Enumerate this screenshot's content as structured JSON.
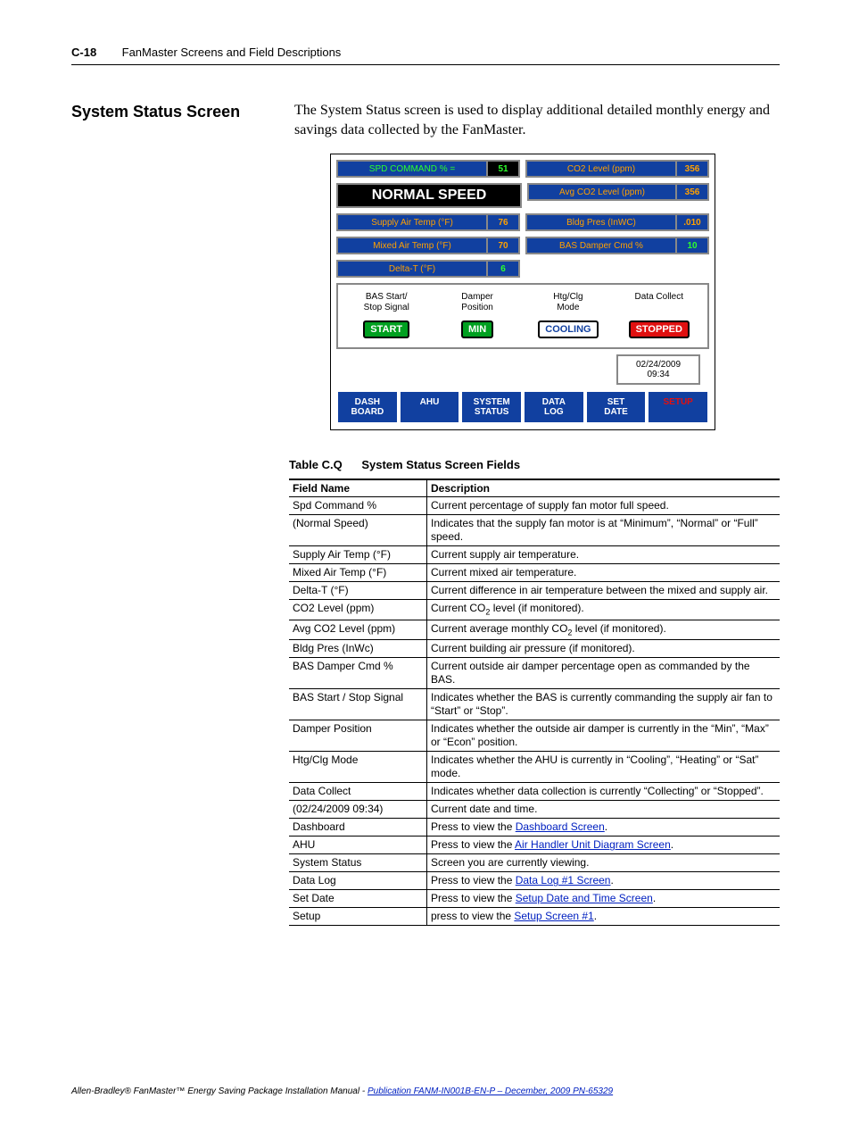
{
  "header": {
    "page_num": "C-18",
    "section": "FanMaster Screens and Field Descriptions"
  },
  "heading": "System Status Screen",
  "intro": "The System Status screen is used to display additional detailed monthly energy and savings data collected by the FanMaster.",
  "screenshot": {
    "spd_cmd_label": "SPD COMMAND % =",
    "spd_cmd_val": "51",
    "co2_label": "CO2 Level (ppm)",
    "co2_val": "356",
    "normal_speed": "NORMAL SPEED",
    "avg_co2_label": "Avg CO2 Level (ppm)",
    "avg_co2_val": "356",
    "supply_label": "Supply Air Temp (°F)",
    "supply_val": "76",
    "bldg_label": "Bldg Pres (InWC)",
    "bldg_val": ".010",
    "mixed_label": "Mixed Air Temp (°F)",
    "mixed_val": "70",
    "bas_label": "BAS Damper Cmd %",
    "bas_val": "10",
    "deltat_label": "Delta-T (°F)",
    "deltat_val": "6",
    "mid": {
      "c1_label": "BAS Start/\nStop Signal",
      "c1_val": "START",
      "c2_label": "Damper\nPosition",
      "c2_val": "MIN",
      "c3_label": "Htg/Clg\nMode",
      "c3_val": "COOLING",
      "c4_label": "Data Collect",
      "c4_val": "STOPPED"
    },
    "datetime": "02/24/2009\n09:34",
    "nav": [
      "DASH\nBOARD",
      "AHU",
      "SYSTEM\nSTATUS",
      "DATA\nLOG",
      "SET\nDATE",
      "SETUP"
    ]
  },
  "table": {
    "label": "Table C.Q",
    "title": "System Status Screen Fields",
    "head_field": "Field Name",
    "head_desc": "Description",
    "rows": [
      {
        "f": "Spd Command %",
        "d": "Current percentage of supply fan motor full speed."
      },
      {
        "f": "(Normal Speed)",
        "d": "Indicates that the supply fan motor is at “Minimum”, “Normal” or “Full” speed."
      },
      {
        "f": "Supply Air Temp (°F)",
        "d": "Current supply air temperature."
      },
      {
        "f": "Mixed Air Temp (°F)",
        "d": "Current mixed air temperature."
      },
      {
        "f": "Delta-T (°F)",
        "d": "Current difference in air temperature between the mixed and supply air."
      },
      {
        "f": "CO2 Level (ppm)",
        "d": "Current CO",
        "sub": "2",
        "d2": " level (if monitored)."
      },
      {
        "f": "Avg CO2 Level (ppm)",
        "d": "Current average monthly CO",
        "sub": "2",
        "d2": " level (if monitored)."
      },
      {
        "f": "Bldg Pres (InWc)",
        "d": "Current building air pressure (if monitored)."
      },
      {
        "f": "BAS Damper Cmd %",
        "d": "Current outside air damper percentage open as commanded by the BAS."
      },
      {
        "f": "BAS Start / Stop Signal",
        "d": "Indicates whether the BAS is currently commanding the supply air fan to “Start” or “Stop”."
      },
      {
        "f": "Damper Position",
        "d": "Indicates whether the outside air damper is currently in the “Min”, “Max” or “Econ” position."
      },
      {
        "f": "Htg/Clg Mode",
        "d": "Indicates whether the AHU is currently in “Cooling”, “Heating” or “Sat” mode."
      },
      {
        "f": "Data Collect",
        "d": "Indicates whether data collection is currently “Collecting” or “Stopped”."
      },
      {
        "f": "(02/24/2009 09:34)",
        "d": "Current date and time."
      },
      {
        "f": "Dashboard",
        "d": "Press to view the ",
        "link": "Dashboard Screen",
        "d2": "."
      },
      {
        "f": "AHU",
        "d": "Press to view the ",
        "link": "Air Handler Unit Diagram Screen",
        "d2": "."
      },
      {
        "f": "System Status",
        "d": "Screen you are currently viewing."
      },
      {
        "f": "Data Log",
        "d": "Press to view the ",
        "link": "Data Log #1 Screen",
        "d2": "."
      },
      {
        "f": "Set Date",
        "d": "Press to view the ",
        "link": "Setup Date and Time Screen",
        "d2": "."
      },
      {
        "f": "Setup",
        "d": "press to view the ",
        "link": "Setup Screen #1",
        "d2": "."
      }
    ]
  },
  "footer": {
    "prefix": "Allen-Bradley® FanMaster™ Energy Saving Package Installation Manual - ",
    "link": "Publication FANM-IN001B-EN-P – December, 2009 PN-65329"
  }
}
